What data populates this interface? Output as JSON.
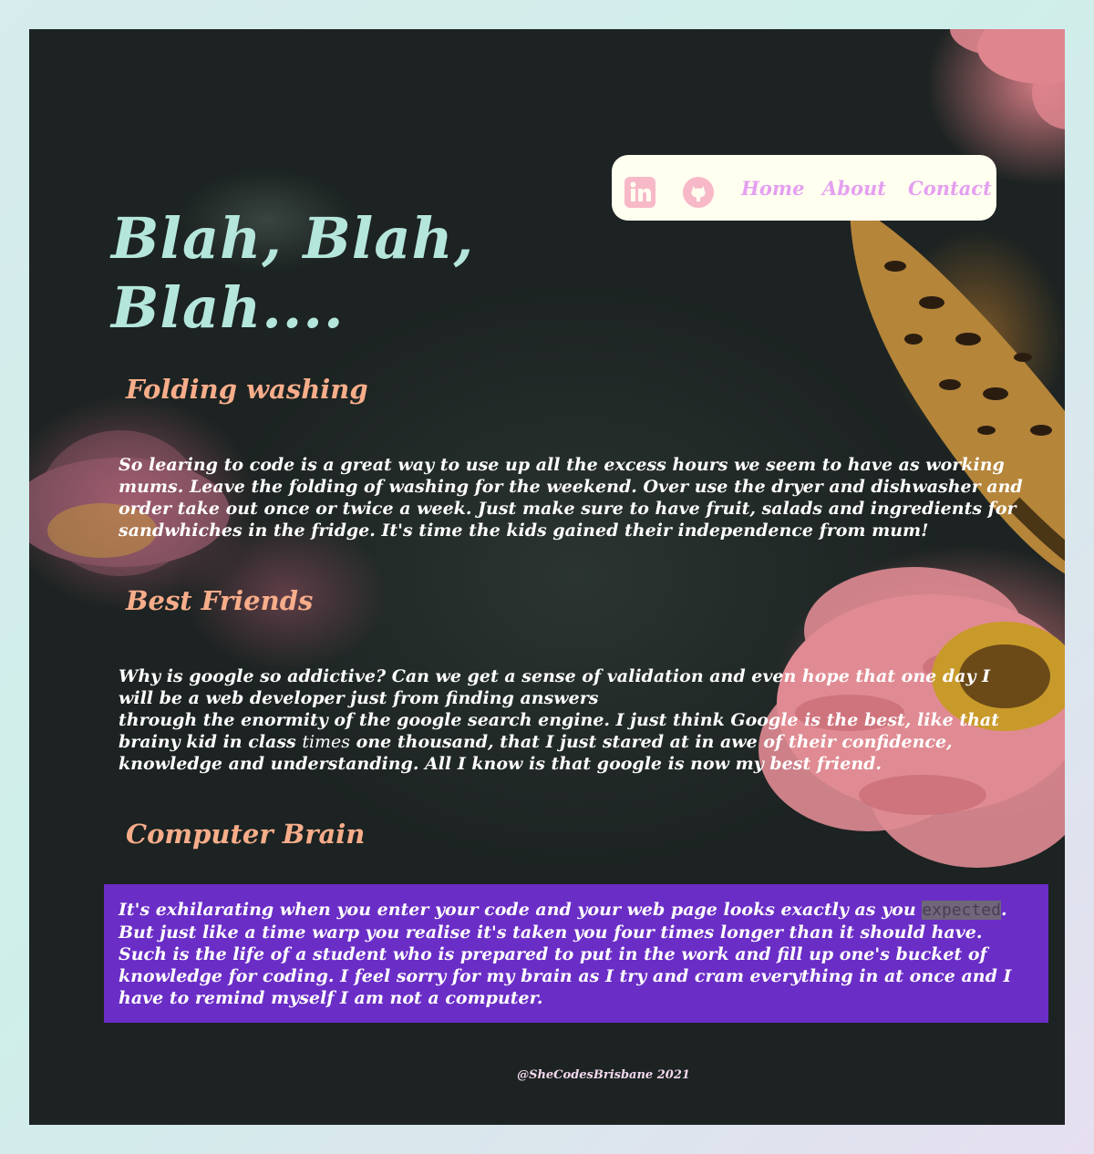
{
  "colors": {
    "title": "#b5e6dc",
    "heading": "#f8ad8a",
    "nav_bg": "#fffff0",
    "nav_link": "#e4a0f0",
    "icon": "#f7b8c8",
    "highlight_box": "#6a2dc6",
    "body_text": "#ffffff"
  },
  "nav": {
    "icons": [
      "linkedin-icon",
      "github-icon"
    ],
    "links": {
      "home": "Home",
      "about": "About",
      "contact": "Contact"
    }
  },
  "hero": {
    "title": "Blah, Blah, Blah...."
  },
  "sections": [
    {
      "heading": "Folding washing",
      "text": "So learing to code is a great way to use up all the excess hours we seem to have as working mums. Leave the folding of washing for the weekend. Over use the dryer and dishwasher and order take out once or twice a week. Just make sure to have fruit, salads and ingredients for sandwhiches in the fridge. It's time the kids gained their independence from mum!"
    },
    {
      "heading": "Best Friends",
      "text_line1": "Why is google so addictive? Can we get a sense of validation and even hope that one day I will be a web developer just from finding answers",
      "text_line2a": "through the enormity of the google search engine. I just think Google is the best, like that brainy kid in class ",
      "text_em": "times",
      "text_line2b": " one thousand, that I just stared at in awe of their confidence, knowledge and understanding. All I know is that google is now my best friend."
    },
    {
      "heading": "Computer Brain",
      "text_a": "It's exhilarating when you enter your code and your web page looks exactly as you ",
      "text_highlight": "expected",
      "text_b": ". But just like a time warp you realise it's taken you four times longer than it should have. Such is the life of a student who is prepared to put in the work and fill up one's bucket of knowledge for coding. I feel sorry for my brain as I try and cram everything in at once and I have to remind myself I am not a computer."
    }
  ],
  "footer": {
    "text": "@SheCodesBrisbane 2021"
  }
}
